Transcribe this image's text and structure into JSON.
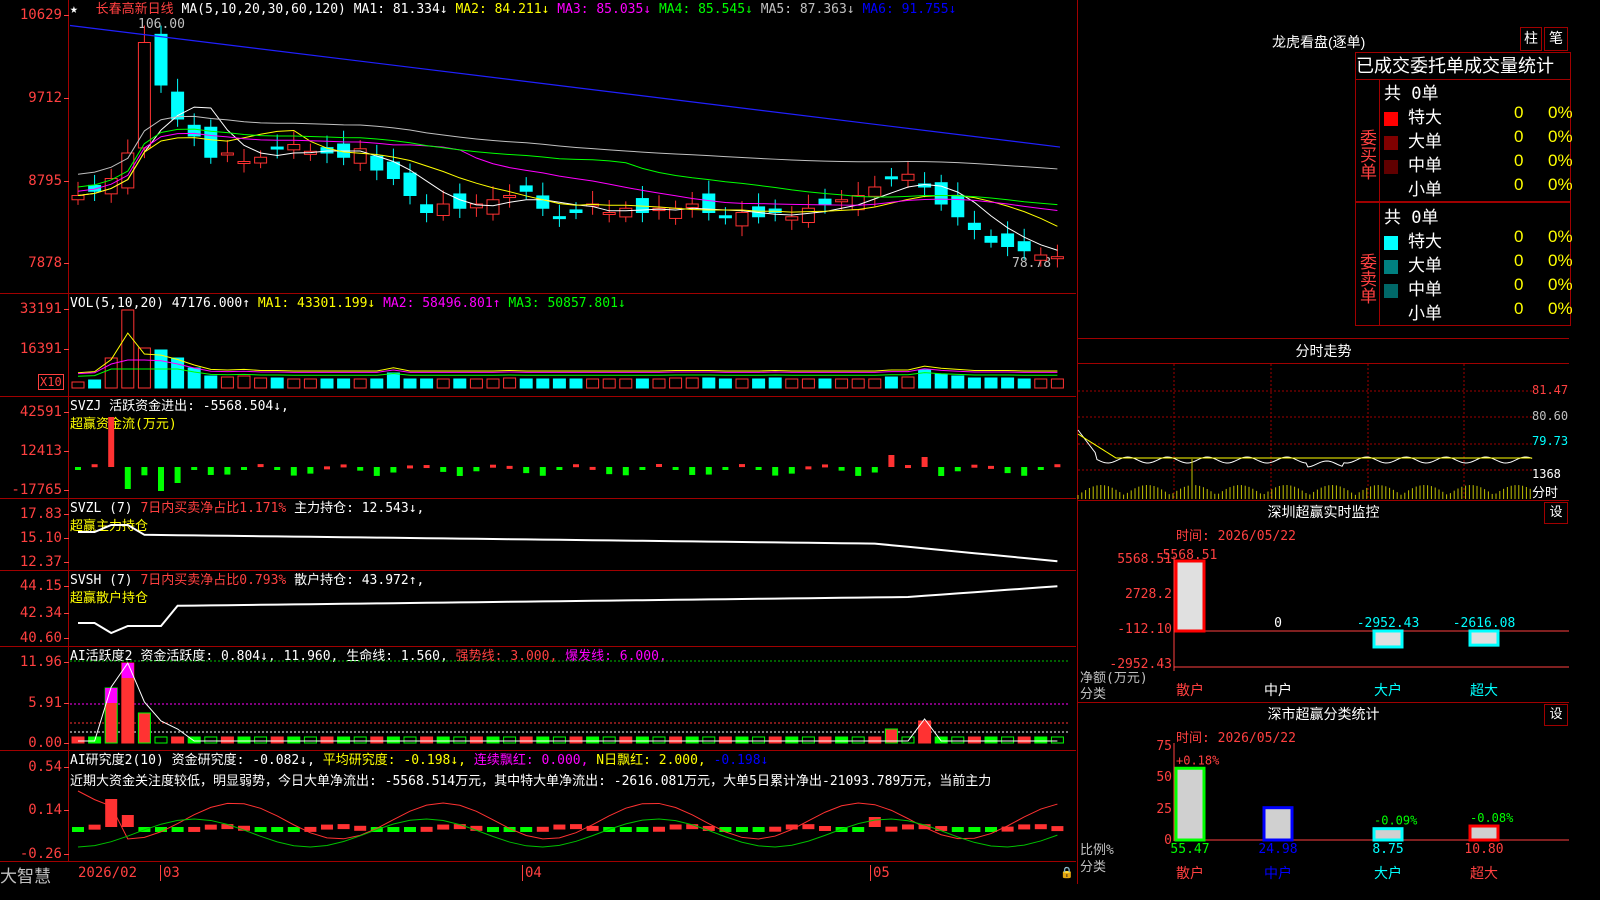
{
  "stock": {
    "name": "长春高新",
    "period": "日线",
    "star": "★"
  },
  "ma": {
    "label": "MA(5,10,20,30,60,120)",
    "items": [
      {
        "text": "MA1: 81.334↓",
        "color": "#ffffff"
      },
      {
        "text": "MA2: 84.211↓",
        "color": "#ffff00"
      },
      {
        "text": "MA3: 85.035↓",
        "color": "#ff00ff"
      },
      {
        "text": "MA4: 85.545↓",
        "color": "#00ff00"
      },
      {
        "text": "MA5: 87.363↓",
        "color": "#c0c0c0"
      },
      {
        "text": "MA6: 91.755↓",
        "color": "#0000ff"
      }
    ]
  },
  "price_axis": [
    "10629",
    "9712",
    "8795",
    "7878"
  ],
  "price_labels": {
    "high": "106.00",
    "low": "78.78"
  },
  "vol": {
    "label": "VOL(5,10,20)",
    "value": "47176.000↑",
    "items": [
      {
        "text": "MA1: 43301.199↓",
        "color": "#ffff00"
      },
      {
        "text": "MA2: 58496.801↑",
        "color": "#ff00ff"
      },
      {
        "text": "MA3: 50857.801↓",
        "color": "#00ff00"
      }
    ],
    "axis": [
      "33191",
      "16391"
    ],
    "unit": "X10"
  },
  "svzj": {
    "label": "SVZJ",
    "text": "活跃资金进出: -5568.504↓,",
    "subtitle": "超赢资金流(万元)",
    "axis": [
      "42591",
      "12413",
      "-17765"
    ]
  },
  "svzl": {
    "label": "SVZL (7)",
    "pct": "7日内买卖净占比1.171%",
    "hold": "主力持仓: 12.543↓,",
    "subtitle": "超赢主力持仓",
    "axis": [
      "17.83",
      "15.10",
      "12.37"
    ]
  },
  "svsh": {
    "label": "SVSH (7)",
    "pct": "7日内买卖净占比0.793%",
    "hold": "散户持仓: 43.972↑,",
    "subtitle": "超赢散户持仓",
    "axis": [
      "44.15",
      "42.34",
      "40.60"
    ]
  },
  "ai1": {
    "label": "AI活跃度2",
    "a": "资金活跃度: 0.804↓,",
    "b": "11.960,",
    "c": "生命线: 1.560,",
    "d": "强势线: 3.000,",
    "e": "爆发线: 6.000,",
    "axis": [
      "11.96",
      "5.91",
      "0.00"
    ]
  },
  "ai2": {
    "label": "AI研究度2(10)",
    "a": "资金研究度: -0.082↓,",
    "b": "平均研究度: -0.198↓,",
    "c": "连续飘红: 0.000,",
    "d": "N日飘红: 2.000,",
    "e": "-0.198↓",
    "axis": [
      "0.54",
      "0.14",
      "-0.26"
    ],
    "comment": "近期大资金关注度较低，明显弱势，今日大单净流出: -5568.514万元，其中特大单净流出: -2616.081万元，大单5日累计净出-21093.789万元，当前主力"
  },
  "dates": {
    "d1": "2026/02",
    "d2": "03",
    "d3": "04",
    "d4": "05"
  },
  "brand": "大智慧",
  "lhb": {
    "title": "龙虎看盘(逐单)",
    "btn1": "柱",
    "btn2": "笔",
    "heading": "已成交委托单成交量统计",
    "buy": {
      "side": "委买单",
      "total": "共 0单",
      "rows": [
        {
          "label": "特大",
          "val": "0",
          "pct": "0%",
          "color": "#ff0000"
        },
        {
          "label": "大单",
          "val": "0",
          "pct": "0%",
          "color": "#800000"
        },
        {
          "label": "中单",
          "val": "0",
          "pct": "0%",
          "color": "#600000"
        },
        {
          "label": "小单",
          "val": "0",
          "pct": "0%",
          "color": "#000000"
        }
      ]
    },
    "sell": {
      "side": "委卖单",
      "total": "共 0单",
      "rows": [
        {
          "label": "特大",
          "val": "0",
          "pct": "0%",
          "color": "#00ffff"
        },
        {
          "label": "大单",
          "val": "0",
          "pct": "0%",
          "color": "#008080"
        },
        {
          "label": "中单",
          "val": "0",
          "pct": "0%",
          "color": "#006868"
        },
        {
          "label": "小单",
          "val": "0",
          "pct": "0%",
          "color": "#000000"
        }
      ]
    }
  },
  "fenshi": {
    "title": "分时走势",
    "axis": [
      "81.47",
      "80.60",
      "79.73",
      "1368",
      "分时"
    ]
  },
  "monitor": {
    "title": "深圳超赢实时监控",
    "btn": "设",
    "time": "时间: 2026/05/22",
    "axis": [
      "5568.51",
      "2728.2",
      "-112.10",
      "-2952.43"
    ],
    "ylabel": "净额(万元)",
    "xlabel": "分类",
    "bars": [
      {
        "cat": "散户",
        "val": "5568.51",
        "color": "#ff0000"
      },
      {
        "cat": "中户",
        "val": "0",
        "color": "#ffffff"
      },
      {
        "cat": "大户",
        "val": "-2952.43",
        "color": "#00ffff"
      },
      {
        "cat": "超大",
        "val": "-2616.08",
        "color": "#00ffff"
      }
    ]
  },
  "classify": {
    "title": "深市超赢分类统计",
    "btn": "设",
    "time": "时间: 2026/05/22",
    "axis": [
      "75",
      "50",
      "25",
      "0"
    ],
    "ylabel": "比例%",
    "xlabel": "分类",
    "bars": [
      {
        "cat": "散户",
        "val": "55.47",
        "chg": "+0.18%",
        "color": "#00ff00"
      },
      {
        "cat": "中户",
        "val": "24.98",
        "chg": "",
        "color": "#0000ff"
      },
      {
        "cat": "大户",
        "val": "8.75",
        "chg": "-0.09%",
        "color": "#00ffff"
      },
      {
        "cat": "超大",
        "val": "10.80",
        "chg": "-0.08%",
        "color": "#ff0000"
      }
    ]
  }
}
